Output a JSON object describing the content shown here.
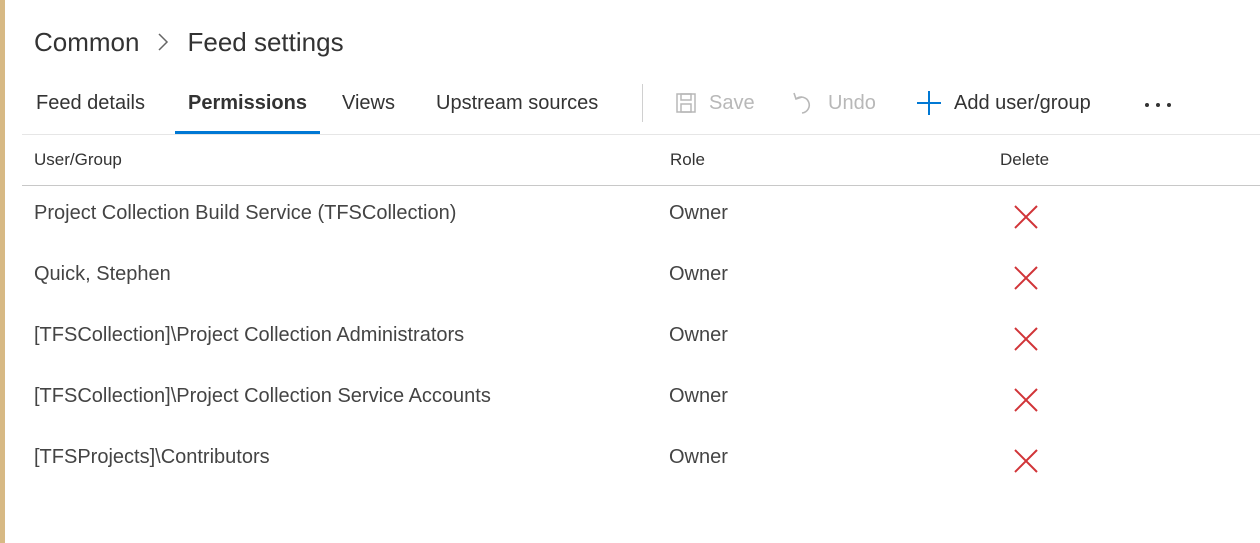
{
  "breadcrumb": {
    "items": [
      "Common",
      "Feed settings"
    ]
  },
  "tabs": [
    {
      "label": "Feed details",
      "active": false
    },
    {
      "label": "Permissions",
      "active": true
    },
    {
      "label": "Views",
      "active": false
    },
    {
      "label": "Upstream sources",
      "active": false
    }
  ],
  "commands": {
    "save": {
      "label": "Save",
      "icon": "save-icon",
      "disabled": true
    },
    "undo": {
      "label": "Undo",
      "icon": "undo-icon",
      "disabled": true
    },
    "add": {
      "label": "Add user/group",
      "icon": "plus-icon",
      "disabled": false
    },
    "more": {
      "icon": "more-icon"
    }
  },
  "table": {
    "columns": [
      "User/Group",
      "Role",
      "Delete"
    ],
    "rows": [
      {
        "user": "Project Collection Build Service (TFSCollection)",
        "role": "Owner"
      },
      {
        "user": "Quick, Stephen",
        "role": "Owner"
      },
      {
        "user": "[TFSCollection]\\Project Collection Administrators",
        "role": "Owner"
      },
      {
        "user": "[TFSCollection]\\Project Collection Service Accounts",
        "role": "Owner"
      },
      {
        "user": "[TFSProjects]\\Contributors",
        "role": "Owner"
      }
    ]
  },
  "colors": {
    "accent": "#0078d4",
    "delete": "#d13438",
    "disabled": "#b8b8b8",
    "window_border": "#d7b984"
  }
}
